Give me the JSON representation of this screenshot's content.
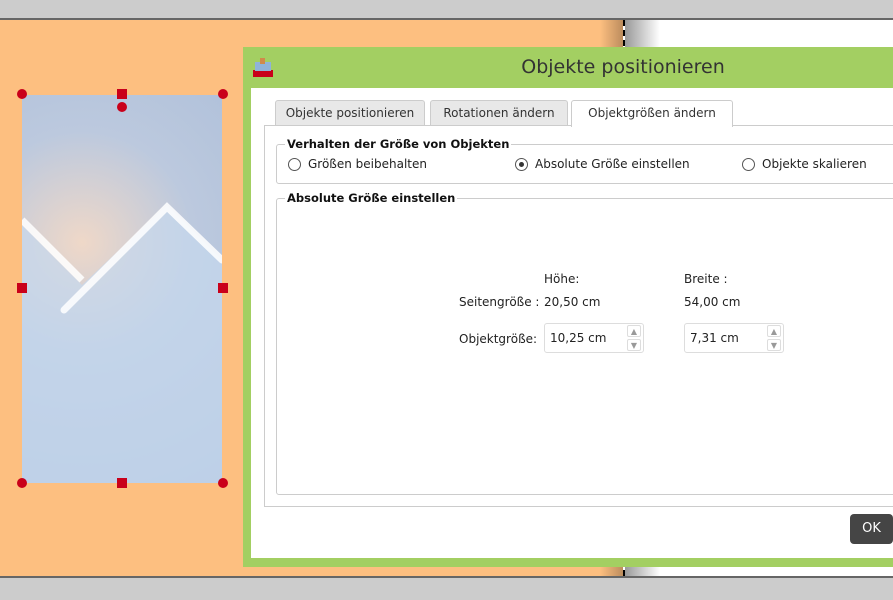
{
  "dialog": {
    "title": "Objekte positionieren"
  },
  "tabs": [
    {
      "label": "Objekte positionieren"
    },
    {
      "label": "Rotationen ändern"
    },
    {
      "label": "Objektgrößen ändern",
      "active": true
    }
  ],
  "behavior": {
    "legend": "Verhalten der Größe von Objekten",
    "options": [
      {
        "label": "Größen beibehalten",
        "selected": false
      },
      {
        "label": "Absolute Größe einstellen",
        "selected": true
      },
      {
        "label": "Objekte skalieren",
        "selected": false
      }
    ]
  },
  "absolute": {
    "legend": "Absolute Größe einstellen",
    "height_header": "Höhe:",
    "width_header": "Breite :",
    "page_size_label": "Seitengröße :",
    "page_height": "20,50 cm",
    "page_width": "54,00 cm",
    "object_size_label": "Objektgröße:",
    "object_height": "10,25 cm",
    "object_width": "7,31 cm"
  },
  "buttons": {
    "ok": "OK"
  },
  "colors": {
    "accent": "#a3cf62",
    "page": "#fdbf80",
    "handle": "#c9001a"
  }
}
